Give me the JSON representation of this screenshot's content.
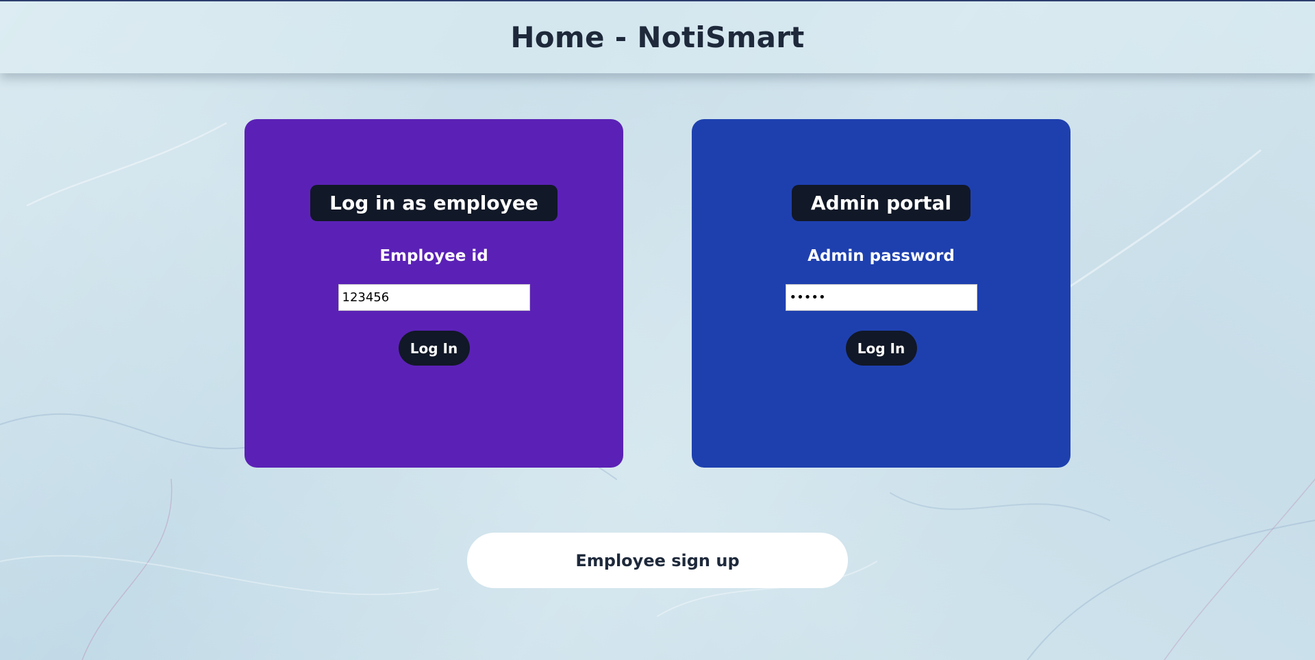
{
  "header": {
    "title": "Home - NotiSmart"
  },
  "employee_card": {
    "heading": "Log in as employee",
    "field_label": "Employee id",
    "field_value": "123456",
    "button_label": "Log In",
    "background_color": "#5b21b6"
  },
  "admin_card": {
    "heading": "Admin portal",
    "field_label": "Admin password",
    "field_value": "•••••",
    "button_label": "Log In",
    "background_color": "#1e40af"
  },
  "signup": {
    "button_label": "Employee sign up"
  }
}
